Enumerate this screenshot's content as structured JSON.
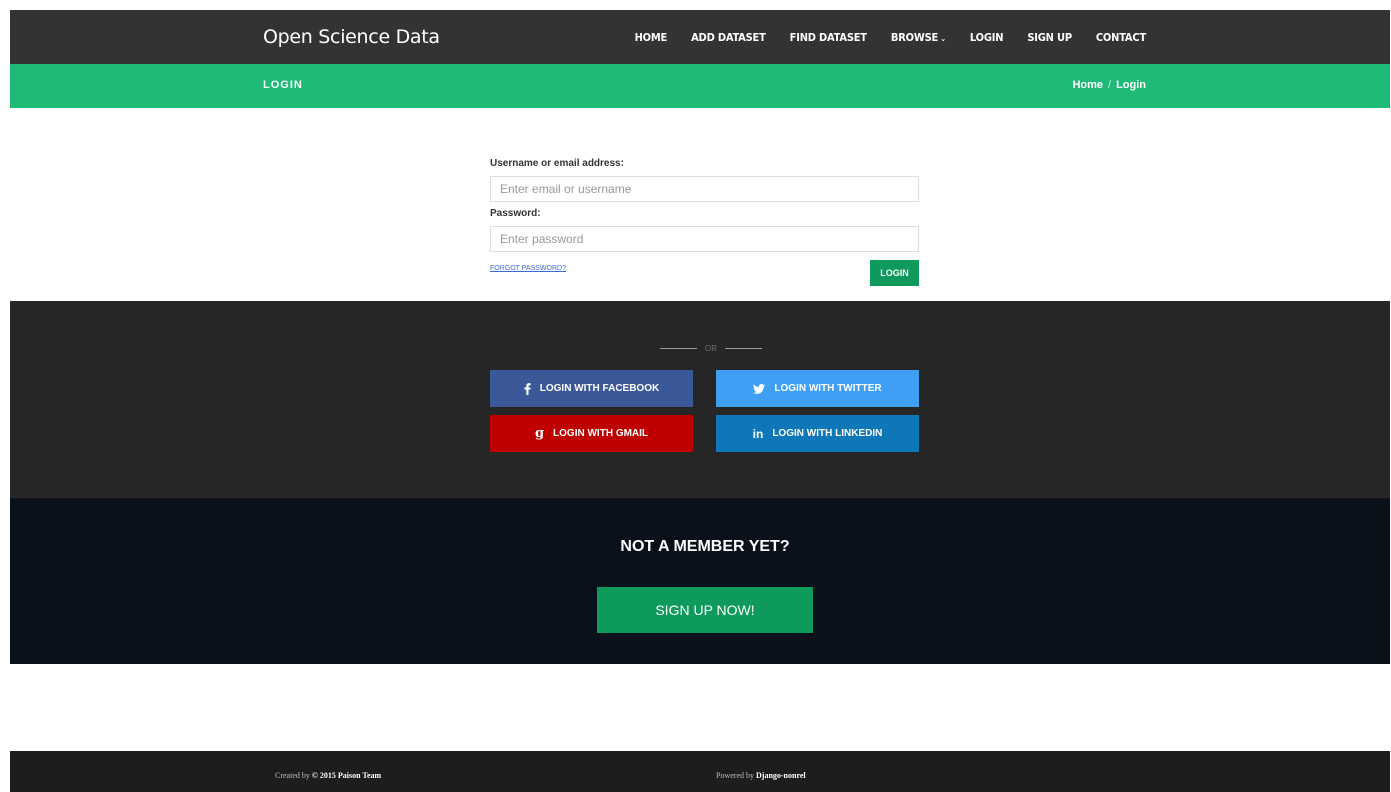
{
  "nav": {
    "brand": "Open Science Data",
    "items": [
      {
        "label": "HOME"
      },
      {
        "label": "ADD DATASET"
      },
      {
        "label": "FIND DATASET"
      },
      {
        "label": "BROWSE"
      },
      {
        "label": "LOGIN"
      },
      {
        "label": "SIGN UP"
      },
      {
        "label": "CONTACT"
      }
    ]
  },
  "titlebar": {
    "title": "LOGIN",
    "breadcrumb": [
      "Home",
      "/",
      "Login"
    ]
  },
  "form": {
    "username_label": "Username or email address:",
    "username_placeholder": "Enter email or username",
    "password_label": "Password:",
    "password_placeholder": "Enter password",
    "forgot": "FORGOT PASSWORD?",
    "submit": "LOGIN"
  },
  "social": {
    "divider": "OR",
    "facebook": "LOGIN WITH FACEBOOK",
    "twitter": "LOGIN WITH TWITTER",
    "gmail": "LOGIN WITH GMAIL",
    "linkedin": "LOGIN WITH LINKEDIN"
  },
  "member": {
    "heading": "NOT A MEMBER YET?",
    "cta": "SIGN UP NOW!"
  },
  "footer": {
    "created_prefix": "Created by",
    "created_strong": "© 2015 Paison Team",
    "powered_prefix": "Powered by",
    "powered_strong": "Django-nonrel"
  },
  "colors": {
    "nav_bg": "#333333",
    "title_bar": "#1fba75",
    "button_green": "#0e9a5a",
    "facebook": "#3b5998",
    "twitter": "#3e9ff5",
    "gmail": "#bf0000",
    "linkedin": "#0d77b7",
    "member_bg": "#0a111a",
    "footer_bg": "#1d1d1d"
  }
}
